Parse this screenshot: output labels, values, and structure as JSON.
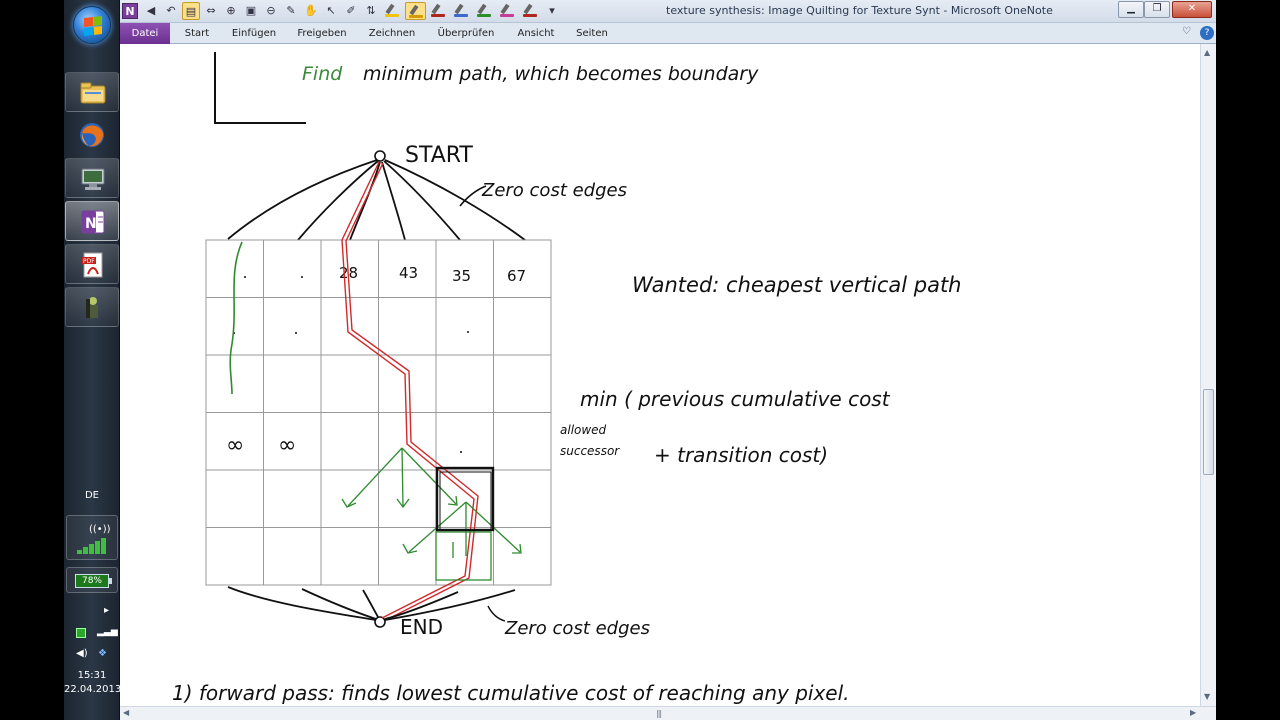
{
  "window": {
    "title": "texture synthesis: Image Quilting for Texture Synt  -  Microsoft OneNote",
    "app_letter": "N"
  },
  "ribbon": {
    "tabs": [
      {
        "name": "tab-datei",
        "label": "Datei"
      },
      {
        "name": "tab-start",
        "label": "Start"
      },
      {
        "name": "tab-einfuegen",
        "label": "Einfügen"
      },
      {
        "name": "tab-freigeben",
        "label": "Freigeben"
      },
      {
        "name": "tab-zeichnen",
        "label": "Zeichnen"
      },
      {
        "name": "tab-ueberpruefen",
        "label": "Überprüfen"
      },
      {
        "name": "tab-ansicht",
        "label": "Ansicht"
      },
      {
        "name": "tab-seiten",
        "label": "Seiten"
      }
    ],
    "help": "?"
  },
  "pen_colors": [
    "#f2c400",
    "#d59a00",
    "#b0261d",
    "#3a6bc6",
    "#2c8f2c",
    "#c43c96",
    "#b0261d"
  ],
  "taskbar": {
    "language": "DE",
    "battery": "78%",
    "time": "15:31",
    "date": "22.04.2013"
  },
  "notes": {
    "top_line_green": "Find",
    "top_line_rest": "minimum path, which becomes boundary",
    "start_label": "START",
    "end_label": "END",
    "zero_cost_top": "Zero cost edges",
    "zero_cost_bottom": "Zero cost edges",
    "cells_row1": [
      "28",
      "43",
      "35",
      "67"
    ],
    "infinity": "∞",
    "wanted": "Wanted: cheapest vertical path",
    "min_formula_1": "min ( previous cumulative cost",
    "min_formula_2": "+ transition cost)",
    "allowed": "allowed",
    "successor": "successor",
    "step1": "1)  forward pass: finds lowest cumulative cost of reaching any pixel."
  }
}
